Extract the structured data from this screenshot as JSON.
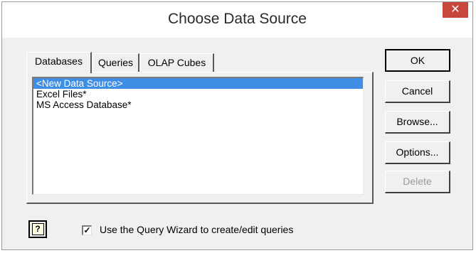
{
  "window": {
    "title": "Choose Data Source",
    "close_label": "✕"
  },
  "tabs": [
    {
      "label": "Databases",
      "active": true
    },
    {
      "label": "Queries",
      "active": false
    },
    {
      "label": "OLAP Cubes",
      "active": false
    }
  ],
  "list": {
    "items": [
      "<New Data Source>",
      "Excel Files*",
      "MS Access Database*"
    ],
    "selected_index": 0
  },
  "buttons": {
    "ok": "OK",
    "cancel": "Cancel",
    "browse": "Browse...",
    "options": "Options...",
    "delete": "Delete"
  },
  "help": {
    "glyph": "?"
  },
  "query_wizard": {
    "checked": true,
    "label": "Use the Query Wizard to create/edit queries"
  },
  "colors": {
    "selection": "#3e8ee6",
    "close_button": "#c8463c"
  }
}
